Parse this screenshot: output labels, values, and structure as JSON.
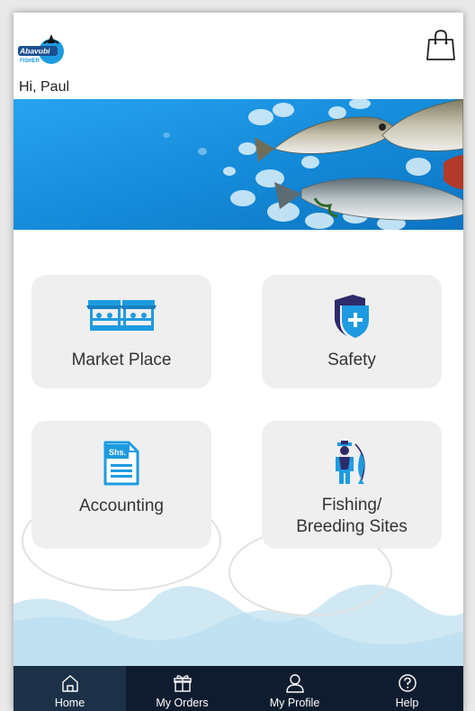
{
  "app": {
    "logo_text": "Abavubi",
    "logo_subtext": "FISHER",
    "greeting": "Hi, Paul"
  },
  "icons": {
    "cart": "shopping-bag-icon",
    "market": "market-stall-icon",
    "safety": "shield-plus-icon",
    "accounting": "shs-document-icon",
    "fishing": "fisherman-icon"
  },
  "tiles": [
    {
      "label": "Market Place"
    },
    {
      "label": "Safety"
    },
    {
      "label": "Accounting"
    },
    {
      "label_line1": "Fishing/",
      "label_line2": "Breeding Sites"
    }
  ],
  "accounting_icon_text": "Shs.",
  "nav": [
    {
      "label": "Home",
      "icon": "home-icon",
      "active": true
    },
    {
      "label": "My Orders",
      "icon": "gift-box-icon",
      "active": false
    },
    {
      "label": "My Profile",
      "icon": "user-icon",
      "active": false
    },
    {
      "label": "Help",
      "icon": "help-circle-icon",
      "active": false
    }
  ],
  "colors": {
    "accent": "#1e9be0",
    "nav_background": "#0f1c2f",
    "nav_active": "#1c3147",
    "tile_background": "#efefef",
    "shield_dark": "#2f2a6b"
  }
}
